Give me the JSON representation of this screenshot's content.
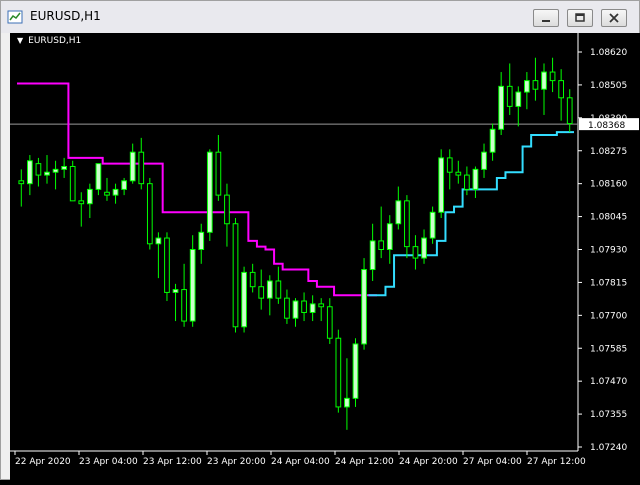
{
  "window": {
    "title": "EURUSD,H1"
  },
  "chart_label": "EURUSD,H1",
  "current_price_label": "1.08368",
  "colors": {
    "background": "#000000",
    "bull_candle": "#ccffcc",
    "wick": "#00ff00",
    "line_high": "#ff00ff",
    "line_low": "#33ddff",
    "axis": "#ffffff"
  },
  "icons": [
    "app-chart-icon",
    "minimize-icon",
    "restore-icon",
    "close-icon",
    "dropdown-arrow-icon"
  ],
  "chart_data": {
    "type": "candlestick",
    "title": "EURUSD,H1",
    "ylim": [
      1.0724,
      1.0862
    ],
    "y_ticks": [
      "1.08620",
      "1.08505",
      "1.08390",
      "1.08275",
      "1.08160",
      "1.08045",
      "1.07930",
      "1.07815",
      "1.07700",
      "1.07585",
      "1.07470",
      "1.07355",
      "1.07240"
    ],
    "x_ticks": [
      "22 Apr 2020",
      "23 Apr 04:00",
      "23 Apr 12:00",
      "23 Apr 20:00",
      "24 Apr 04:00",
      "24 Apr 12:00",
      "24 Apr 20:00",
      "27 Apr 04:00",
      "27 Apr 12:00"
    ],
    "current_price": 1.08368,
    "candles": [
      [
        1.0817,
        1.0821,
        1.0808,
        1.0816
      ],
      [
        1.0816,
        1.0826,
        1.0812,
        1.0824
      ],
      [
        1.0823,
        1.0825,
        1.0815,
        1.0819
      ],
      [
        1.0819,
        1.0826,
        1.0816,
        1.082
      ],
      [
        1.082,
        1.0824,
        1.0814,
        1.0821
      ],
      [
        1.0821,
        1.0825,
        1.0818,
        1.0822
      ],
      [
        1.0822,
        1.0824,
        1.081,
        1.081
      ],
      [
        1.081,
        1.0813,
        1.0801,
        1.0809
      ],
      [
        1.0809,
        1.0816,
        1.0804,
        1.0814
      ],
      [
        1.0814,
        1.0823,
        1.0812,
        1.0823
      ],
      [
        1.0813,
        1.0818,
        1.081,
        1.0812
      ],
      [
        1.0812,
        1.0816,
        1.0809,
        1.0814
      ],
      [
        1.0814,
        1.0818,
        1.0812,
        1.0817
      ],
      [
        1.0817,
        1.083,
        1.0816,
        1.0827
      ],
      [
        1.0827,
        1.0832,
        1.0814,
        1.0816
      ],
      [
        1.0816,
        1.0818,
        1.0793,
        1.0795
      ],
      [
        1.0795,
        1.0799,
        1.0783,
        1.0797
      ],
      [
        1.0797,
        1.0799,
        1.0775,
        1.0778
      ],
      [
        1.0778,
        1.0781,
        1.0768,
        1.0779
      ],
      [
        1.0779,
        1.0788,
        1.0766,
        1.0768
      ],
      [
        1.0768,
        1.0798,
        1.0766,
        1.0793
      ],
      [
        1.0793,
        1.0802,
        1.0788,
        1.0799
      ],
      [
        1.0799,
        1.0828,
        1.0796,
        1.0827
      ],
      [
        1.0827,
        1.0833,
        1.081,
        1.0812
      ],
      [
        1.0812,
        1.0816,
        1.0794,
        1.0802
      ],
      [
        1.0802,
        1.0804,
        1.0764,
        1.0766
      ],
      [
        1.0766,
        1.0787,
        1.0764,
        1.0785
      ],
      [
        1.0785,
        1.0788,
        1.0778,
        1.078
      ],
      [
        1.078,
        1.0786,
        1.0772,
        1.0776
      ],
      [
        1.0776,
        1.0784,
        1.077,
        1.0782
      ],
      [
        1.0782,
        1.0787,
        1.0774,
        1.0776
      ],
      [
        1.0776,
        1.0779,
        1.0767,
        1.0769
      ],
      [
        1.0769,
        1.0776,
        1.0766,
        1.0775
      ],
      [
        1.0775,
        1.0778,
        1.0768,
        1.0771
      ],
      [
        1.0771,
        1.0777,
        1.0768,
        1.0774
      ],
      [
        1.0774,
        1.0776,
        1.0768,
        1.0773
      ],
      [
        1.0773,
        1.0776,
        1.076,
        1.0762
      ],
      [
        1.0762,
        1.0765,
        1.0736,
        1.0738
      ],
      [
        1.0738,
        1.0755,
        1.073,
        1.0741
      ],
      [
        1.0741,
        1.0762,
        1.0738,
        1.076
      ],
      [
        1.076,
        1.079,
        1.0758,
        1.0786
      ],
      [
        1.0786,
        1.0802,
        1.0782,
        1.0796
      ],
      [
        1.0796,
        1.0808,
        1.079,
        1.0793
      ],
      [
        1.0793,
        1.0805,
        1.0788,
        1.0802
      ],
      [
        1.0802,
        1.0815,
        1.08,
        1.081
      ],
      [
        1.081,
        1.0812,
        1.079,
        1.0794
      ],
      [
        1.0794,
        1.0798,
        1.0786,
        1.079
      ],
      [
        1.079,
        1.08,
        1.0788,
        1.0797
      ],
      [
        1.0797,
        1.0808,
        1.0795,
        1.0806
      ],
      [
        1.0806,
        1.0828,
        1.0804,
        1.0825
      ],
      [
        1.0825,
        1.0828,
        1.0814,
        1.082
      ],
      [
        1.082,
        1.0824,
        1.0816,
        1.0819
      ],
      [
        1.0819,
        1.0822,
        1.0812,
        1.0814
      ],
      [
        1.0814,
        1.0822,
        1.0811,
        1.0821
      ],
      [
        1.0821,
        1.083,
        1.0818,
        1.0827
      ],
      [
        1.0827,
        1.0837,
        1.0824,
        1.0835
      ],
      [
        1.0835,
        1.0855,
        1.0833,
        1.085
      ],
      [
        1.085,
        1.0858,
        1.084,
        1.0843
      ],
      [
        1.0843,
        1.085,
        1.0836,
        1.0848
      ],
      [
        1.0848,
        1.0855,
        1.0842,
        1.0852
      ],
      [
        1.0852,
        1.086,
        1.0845,
        1.0849
      ],
      [
        1.0849,
        1.0858,
        1.084,
        1.0855
      ],
      [
        1.0855,
        1.086,
        1.0848,
        1.0852
      ],
      [
        1.0852,
        1.0856,
        1.0838,
        1.0846
      ],
      [
        1.0846,
        1.0849,
        1.0834,
        1.0837
      ]
    ],
    "series": [
      {
        "values": [
          1.0851,
          1.0851,
          1.0851,
          1.0851,
          1.0851,
          1.0851,
          1.0825,
          1.0825,
          1.0825,
          1.0825,
          1.0823,
          1.0823,
          1.0823,
          1.0823,
          1.0823,
          1.0823,
          1.0823,
          1.0806,
          1.0806,
          1.0806,
          1.0806,
          1.0806,
          1.0806,
          1.0806,
          1.0806,
          1.0806,
          1.0806,
          1.0796,
          1.0794,
          1.0793,
          1.0788,
          1.0786,
          1.0786,
          1.0786,
          1.0782,
          1.078,
          1.078,
          1.0777,
          1.0777,
          1.0777,
          1.0777,
          1.0777,
          null,
          null,
          null,
          null,
          null,
          null,
          null,
          null,
          null,
          null,
          null,
          null,
          null,
          null,
          null,
          null,
          null,
          null,
          null,
          null,
          null,
          null,
          null
        ]
      },
      {
        "values": [
          null,
          null,
          null,
          null,
          null,
          null,
          null,
          null,
          null,
          null,
          null,
          null,
          null,
          null,
          null,
          null,
          null,
          null,
          null,
          null,
          null,
          null,
          null,
          null,
          null,
          null,
          null,
          null,
          null,
          null,
          null,
          null,
          null,
          null,
          null,
          null,
          null,
          null,
          null,
          null,
          null,
          1.0777,
          1.0777,
          1.078,
          1.0791,
          1.0791,
          1.0791,
          1.0791,
          1.0791,
          1.0796,
          1.0806,
          1.0808,
          1.0814,
          1.0814,
          1.0814,
          1.0814,
          1.0818,
          1.082,
          1.082,
          1.0829,
          1.0833,
          1.0833,
          1.0833,
          1.0834,
          1.0834
        ]
      }
    ]
  }
}
